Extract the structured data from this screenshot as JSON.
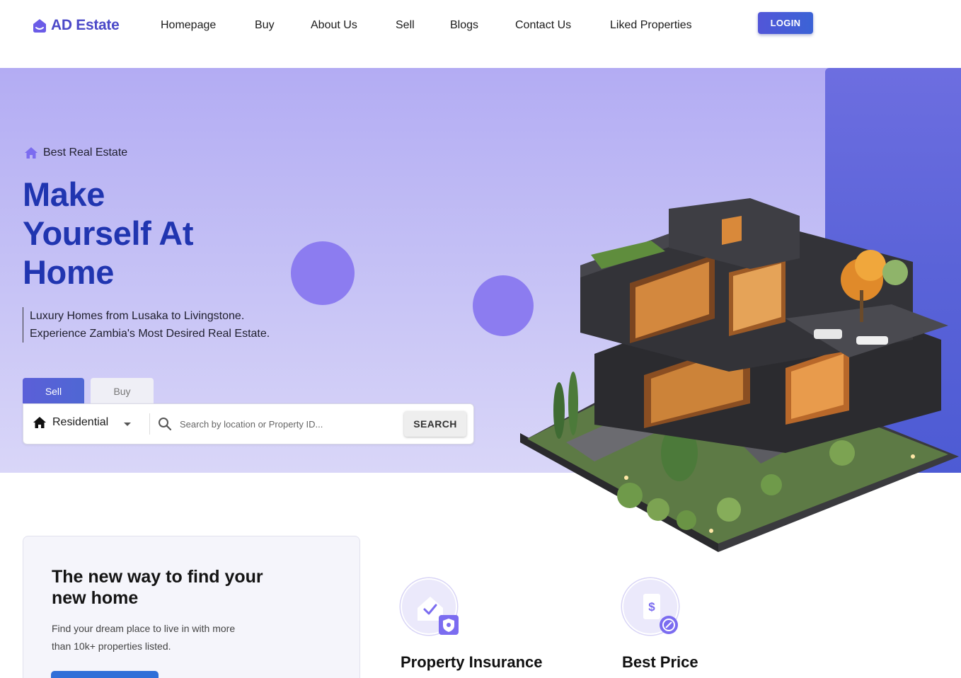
{
  "brand": {
    "name": "AD Estate",
    "color": "#4b49c8"
  },
  "nav": {
    "links": [
      "Homepage",
      "Buy",
      "About Us",
      "Sell",
      "Blogs",
      "Contact Us",
      "Liked Properties"
    ],
    "login_label": "LOGIN"
  },
  "hero": {
    "tagline": "Best Real Estate",
    "title_lines": [
      "Make",
      "Yourself At",
      "Home"
    ],
    "subtitle_lines": [
      "Luxury Homes from Lusaka to Livingstone.",
      "Experience Zambia's Most Desired Real Estate."
    ],
    "accent_color": "#2035b0"
  },
  "search": {
    "tabs": [
      {
        "label": "Sell",
        "active": true
      },
      {
        "label": "Buy",
        "active": false
      }
    ],
    "property_type": "Residential",
    "placeholder": "Search by location or Property ID...",
    "button_label": "SEARCH"
  },
  "info_card": {
    "title": "The new way to find your new home",
    "text": "Find your dream place to live in with more than 10k+ properties listed."
  },
  "features": [
    {
      "title": "Property Insurance",
      "icon": "house-shield-icon"
    },
    {
      "title": "Best Price",
      "icon": "price-tag-icon"
    }
  ]
}
